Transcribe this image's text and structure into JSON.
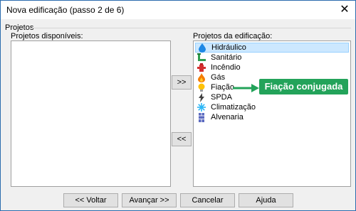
{
  "window": {
    "title": "Nova edificação (passo 2 de 6)",
    "close_glyph": "✕"
  },
  "group": {
    "label": "Projetos"
  },
  "available": {
    "label": "Projetos disponíveis:",
    "items": []
  },
  "selected_list": {
    "label": "Projetos da edificação:",
    "items": [
      {
        "label": "Hidráulico",
        "icon": "water-drop-icon",
        "selected": true
      },
      {
        "label": "Sanitário",
        "icon": "pipe-icon"
      },
      {
        "label": "Incêndio",
        "icon": "fire-hydrant-icon"
      },
      {
        "label": "Gás",
        "icon": "gas-flame-icon"
      },
      {
        "label": "Fiação",
        "icon": "light-bulb-icon"
      },
      {
        "label": "SPDA",
        "icon": "lightning-icon"
      },
      {
        "label": "Climatização",
        "icon": "snowflake-icon"
      },
      {
        "label": "Alvenaria",
        "icon": "wall-icon"
      }
    ]
  },
  "buttons": {
    "add": ">>",
    "remove": "<<",
    "back": "<< Voltar",
    "next": "Avançar >>",
    "cancel": "Cancelar",
    "help": "Ajuda"
  },
  "callout": {
    "text": "Fiação conjugada",
    "color": "#23a35a"
  }
}
